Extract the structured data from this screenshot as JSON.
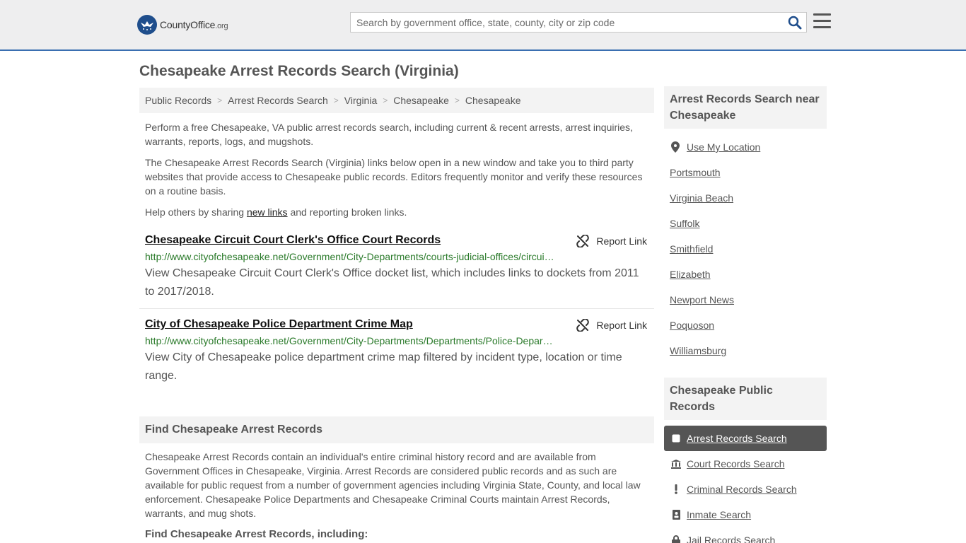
{
  "header": {
    "logo_main": "CountyOffice",
    "logo_suffix": ".org",
    "search_placeholder": "Search by government office, state, county, city or zip code"
  },
  "page_title": "Chesapeake Arrest Records Search (Virginia)",
  "breadcrumb": [
    "Public Records",
    "Arrest Records Search",
    "Virginia",
    "Chesapeake",
    "Chesapeake"
  ],
  "intro": {
    "p1": "Perform a free Chesapeake, VA public arrest records search, including current & recent arrests, arrest inquiries, warrants, reports, logs, and mugshots.",
    "p2": "The Chesapeake Arrest Records Search (Virginia) links below open in a new window and take you to third party websites that provide access to Chesapeake public records. Editors frequently monitor and verify these resources on a routine basis.",
    "p3_before": "Help others by sharing ",
    "p3_link": "new links",
    "p3_after": " and reporting broken links."
  },
  "results": [
    {
      "title": "Chesapeake Circuit Court Clerk's Office Court Records",
      "url": "http://www.cityofchesapeake.net/Government/City-Departments/courts-judicial-offices/circuit-court-clerk.htm",
      "description": "View Chesapeake Circuit Court Clerk's Office docket list, which includes links to dockets from 2011 to 2017/2018.",
      "report_label": "Report Link"
    },
    {
      "title": "City of Chesapeake Police Department Crime Map",
      "url": "http://www.cityofchesapeake.net/Government/City-Departments/Departments/Police-Department/crime-map.htm",
      "description": "View City of Chesapeake police department crime map filtered by incident type, location or time range.",
      "report_label": "Report Link"
    }
  ],
  "find_section": {
    "header": "Find Chesapeake Arrest Records",
    "body": "Chesapeake Arrest Records contain an individual's entire criminal history record and are available from Government Offices in Chesapeake, Virginia. Arrest Records are considered public records and as such are available for public request from a number of government agencies including Virginia State, County, and local law enforcement. Chesapeake Police Departments and Chesapeake Criminal Courts maintain Arrest Records, warrants, and mug shots.",
    "subheader": "Find Chesapeake Arrest Records, including:"
  },
  "sidebar": {
    "nearby_header": "Arrest Records Search near Chesapeake",
    "use_location": "Use My Location",
    "nearby": [
      "Portsmouth",
      "Virginia Beach",
      "Suffolk",
      "Smithfield",
      "Elizabeth",
      "Newport News",
      "Poquoson",
      "Williamsburg"
    ],
    "public_records_header": "Chesapeake Public Records",
    "public_records": [
      {
        "label": "Arrest Records Search",
        "icon": "square-icon",
        "active": true
      },
      {
        "label": "Court Records Search",
        "icon": "courthouse-icon",
        "active": false
      },
      {
        "label": "Criminal Records Search",
        "icon": "exclamation-icon",
        "active": false
      },
      {
        "label": "Inmate Search",
        "icon": "id-badge-icon",
        "active": false
      },
      {
        "label": "Jail Records Search",
        "icon": "lock-icon",
        "active": false
      }
    ]
  },
  "colors": {
    "header_bg": "#eeeeef",
    "header_border": "#3a6fb1",
    "logo_blue": "#1f4e8c",
    "url_green": "#2a7a2a",
    "active_bg": "#555555"
  }
}
